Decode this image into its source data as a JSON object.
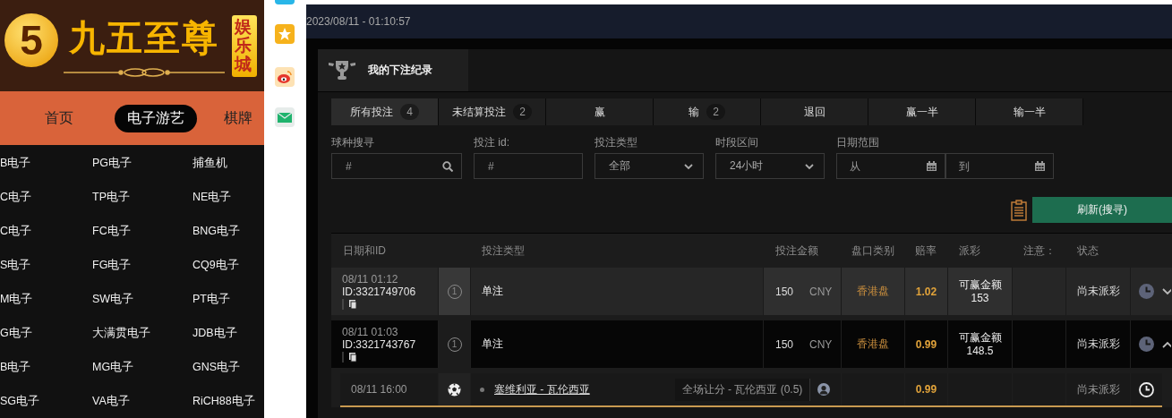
{
  "site": {
    "logo_mark": "5",
    "logo_text": "九五至尊",
    "logo_badge": "娱乐城",
    "nav": [
      {
        "label": "首页",
        "selected": false
      },
      {
        "label": "电子游艺",
        "selected": true
      },
      {
        "label": "棋牌",
        "selected": false
      }
    ],
    "games": [
      "B电子",
      "PG电子",
      "捕鱼机",
      "C电子",
      "TP电子",
      "NE电子",
      "C电子",
      "FC电子",
      "BNG电子",
      "S电子",
      "FG电子",
      "CQ9电子",
      "M电子",
      "SW电子",
      "PT电子",
      "G电子",
      "大满贯电子",
      "JDB电子",
      "B电子",
      "MG电子",
      "GNS电子",
      "SG电子",
      "VA电子",
      "RiCH88电子"
    ]
  },
  "share_icons": [
    {
      "kind": "app"
    },
    {
      "kind": "star"
    },
    {
      "kind": "weibo"
    },
    {
      "kind": "mail"
    }
  ],
  "clock": "2023/08/11 - 01:10:57",
  "panel": {
    "title": "我的下注纪录",
    "tabs": [
      {
        "label": "所有投注",
        "count": "4",
        "selected": true
      },
      {
        "label": "未结算投注",
        "count": "2",
        "selected": false
      },
      {
        "label": "赢",
        "selected": false
      },
      {
        "label": "输",
        "count": "2",
        "selected": false
      },
      {
        "label": "退回",
        "selected": false
      },
      {
        "label": "赢一半",
        "selected": false
      },
      {
        "label": "输一半",
        "selected": false
      }
    ],
    "filters": [
      {
        "kind": "search",
        "label": "球种搜寻",
        "placeholder": "#"
      },
      {
        "kind": "text",
        "label": "投注 id:",
        "placeholder": "#"
      },
      {
        "kind": "select",
        "label": "投注类型",
        "value": "全部"
      },
      {
        "kind": "select",
        "label": "时段区间",
        "value": "24小时"
      },
      {
        "kind": "date_range",
        "label": "日期范围",
        "from_placeholder": "从",
        "to_placeholder": "到"
      }
    ],
    "refresh_button": "刷新(搜寻)",
    "table": {
      "columns": [
        "日期和ID",
        "投注类型",
        "投注金额",
        "盘口类别",
        "赔率",
        "派彩",
        "注意：",
        "状态"
      ],
      "rows": [
        {
          "date": "08/11 01:12",
          "id": "ID:3321749706",
          "legs": "1",
          "bet_type": "单注",
          "amount": "150",
          "currency": "CNY",
          "market": "香港盘",
          "odds": "1.02",
          "payout_label": "可赢金额",
          "payout_value": "153",
          "status": "尚未派彩",
          "selected": true,
          "expanded": false
        },
        {
          "date": "08/11 01:03",
          "id": "ID:3321743767",
          "legs": "1",
          "bet_type": "单注",
          "amount": "150",
          "currency": "CNY",
          "market": "香港盘",
          "odds": "0.99",
          "payout_label": "可赢金额",
          "payout_value": "148.5",
          "status": "尚未派彩",
          "selected": false,
          "expanded": true,
          "details": [
            {
              "time": "08/11 16:00",
              "match": "塞维利亚 - 瓦伦西亚",
              "selection": "全场让分 - 瓦伦西亚 (0.5)",
              "odds": "0.99",
              "status": "尚未派彩"
            }
          ]
        }
      ]
    }
  }
}
